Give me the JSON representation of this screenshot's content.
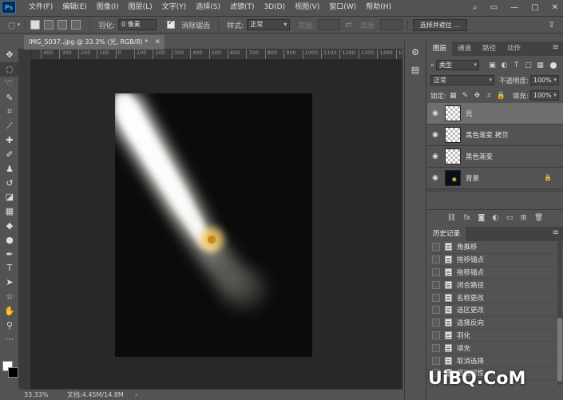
{
  "menu": {
    "logo": "Ps",
    "items": [
      "文件(F)",
      "编辑(E)",
      "图像(I)",
      "图层(L)",
      "文字(Y)",
      "选择(S)",
      "滤镜(T)",
      "3D(D)",
      "视图(V)",
      "窗口(W)",
      "帮助(H)"
    ]
  },
  "options": {
    "feather_label": "羽化:",
    "feather_value": "0 像素",
    "antialias_label": "消除锯齿",
    "style_label": "样式:",
    "style_value": "正常",
    "width_label": "宽度:",
    "height_label": "高度:",
    "select_mask_button": "选择并遮住 ..."
  },
  "document": {
    "tab_title": "IMG_5037..jpg @ 33.3% (光, RGB/8) *",
    "zoom": "33.33%",
    "doc_info": "文档:4.45M/14.8M"
  },
  "ruler": {
    "ticks": [
      "400",
      "300",
      "200",
      "100",
      "0",
      "100",
      "200",
      "300",
      "400",
      "500",
      "600",
      "700",
      "800",
      "900",
      "1000",
      "1100",
      "1200",
      "1300",
      "1400",
      "1500"
    ]
  },
  "layers_panel": {
    "tabs": [
      "图层",
      "通道",
      "路径",
      "动作"
    ],
    "filter_label": "类型",
    "blend_mode": "正常",
    "opacity_label": "不透明度:",
    "opacity_value": "100%",
    "lock_label": "锁定:",
    "fill_label": "填充:",
    "fill_value": "100%",
    "layers": [
      {
        "name": "光",
        "selected": true,
        "thumb": "transparent"
      },
      {
        "name": "黑色渐变 拷贝",
        "selected": false,
        "thumb": "transparent"
      },
      {
        "name": "黑色渐变",
        "selected": false,
        "thumb": "transparent"
      },
      {
        "name": "背景",
        "selected": false,
        "thumb": "dark",
        "locked": true
      }
    ],
    "footer_icons": [
      "link-icon",
      "fx-icon",
      "mask-icon",
      "adjustment-icon",
      "group-icon",
      "new-layer-icon",
      "trash-icon"
    ]
  },
  "history_panel": {
    "title": "历史记录",
    "items": [
      "角推移",
      "拖移锚点",
      "拖移锚点",
      "闭合路径",
      "名称更改",
      "选区更改",
      "选择反向",
      "羽化",
      "填充",
      "取消选择",
      "图层属性"
    ]
  },
  "watermark": "UiBQ.CoM",
  "colors": {
    "foreground": "#ffffff",
    "background": "#000000",
    "ui_bg": "#535353",
    "canvas_bg": "#282828"
  }
}
